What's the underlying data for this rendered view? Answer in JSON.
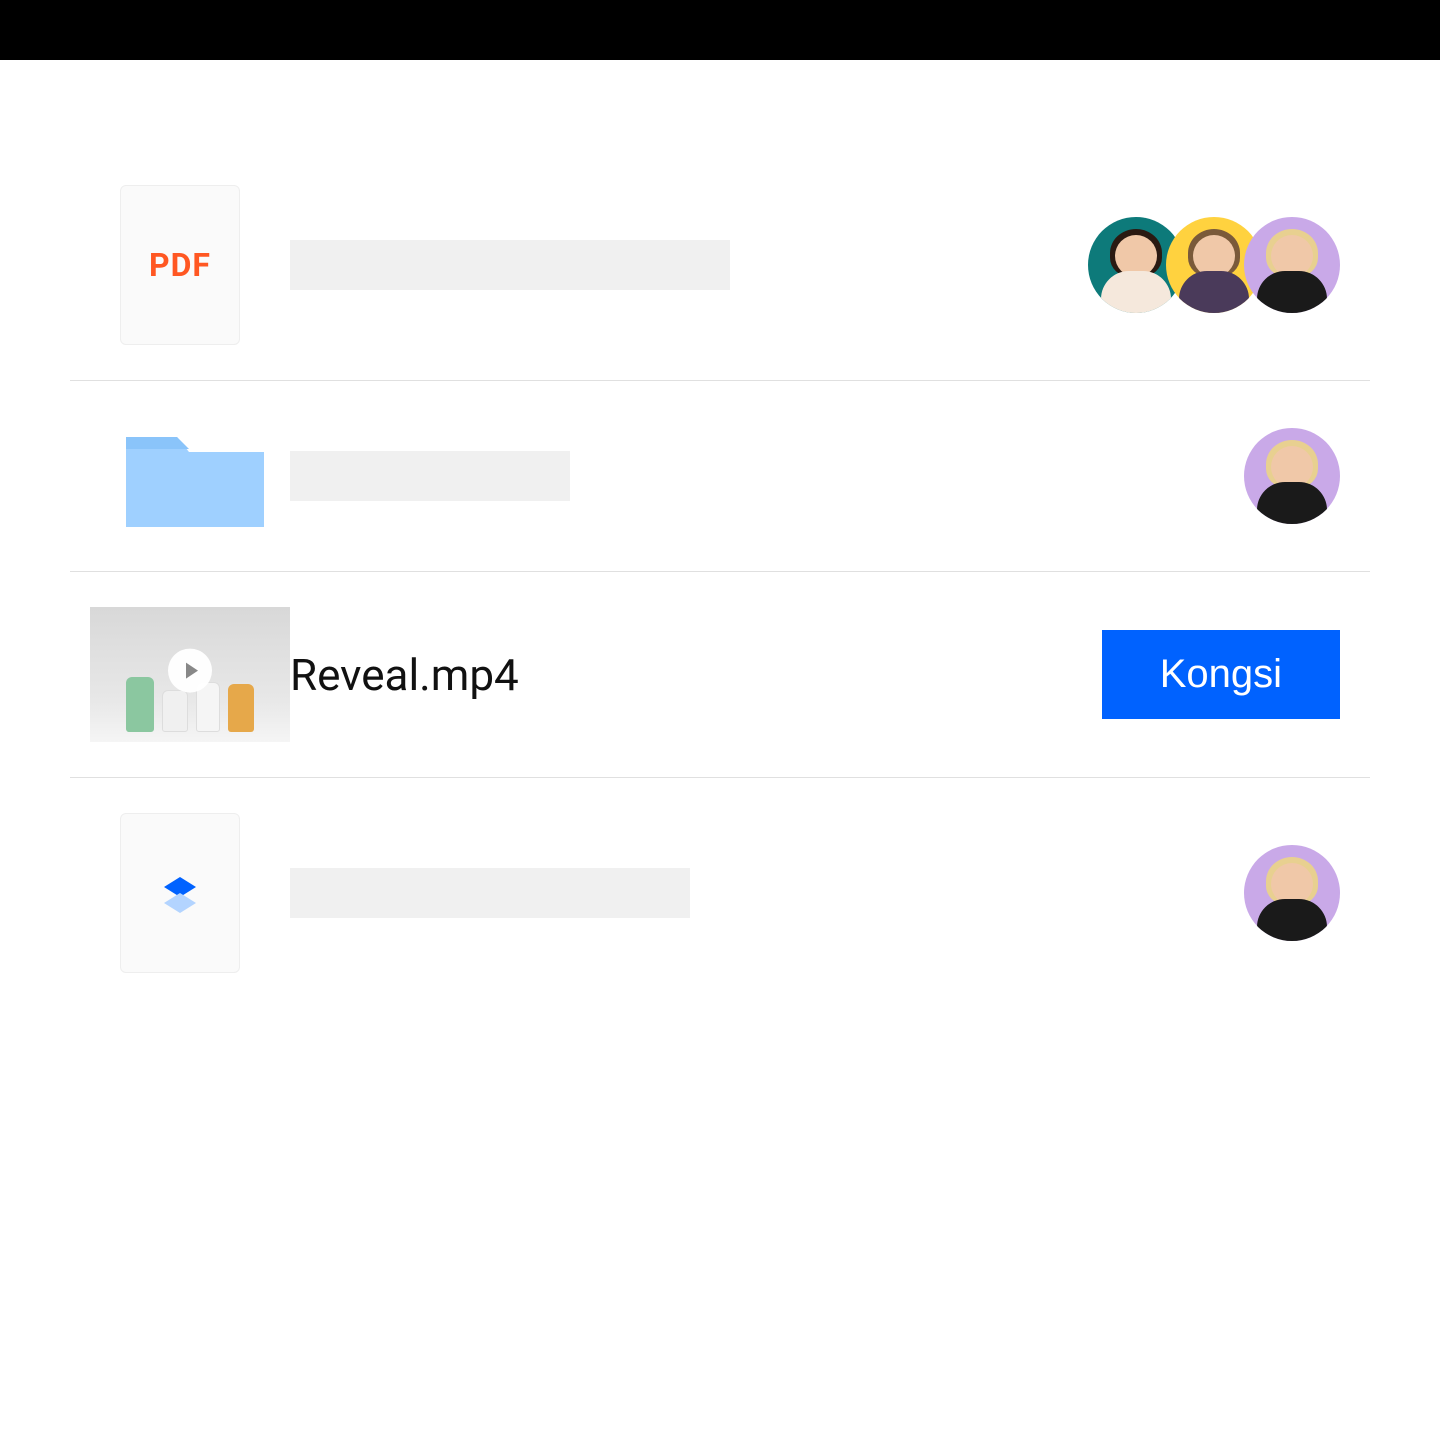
{
  "rows": [
    {
      "type": "pdf",
      "pdf_label": "PDF",
      "avatars": [
        "teal",
        "yellow",
        "purple"
      ]
    },
    {
      "type": "folder",
      "avatars": [
        "purple"
      ]
    },
    {
      "type": "video",
      "filename": "Reveal.mp4",
      "share_label": "Kongsi"
    },
    {
      "type": "dropbox-file",
      "avatars": [
        "purple"
      ]
    }
  ],
  "colors": {
    "accent": "#0062ff",
    "pdf_text": "#ff5722",
    "folder": "#9fd0ff"
  }
}
